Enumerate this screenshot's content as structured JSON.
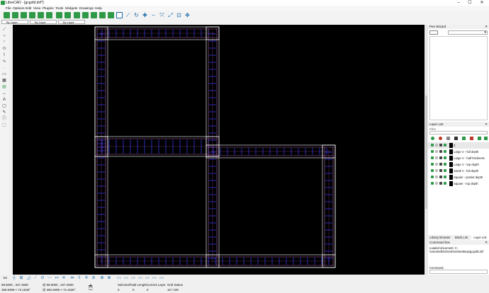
{
  "window": {
    "title": "LibreCAD - [gcgsfd.dxf*]",
    "minimize": "–",
    "maximize": "☐",
    "close": "✕"
  },
  "menu": [
    "File",
    "Options",
    "Edit",
    "View",
    "Plugins",
    "Tools",
    "Widgets",
    "Drawings",
    "Help"
  ],
  "attributes": {
    "color": "By Layer",
    "linetype": "By Layer",
    "width": "By Layer"
  },
  "pen_wizard": {
    "title": "Pen Wizard"
  },
  "layer_list": {
    "title": "Layer List",
    "filter_label": "Filter",
    "layers": [
      {
        "name": "0"
      },
      {
        "name": "Large V - full depth"
      },
      {
        "name": "Large V - half thickness"
      },
      {
        "name": "Large V - top depth"
      },
      {
        "name": "Small V - full depth"
      },
      {
        "name": "Square - pocket depth"
      },
      {
        "name": "Square - top depth"
      }
    ],
    "tabs": [
      "Library Browser",
      "Block List",
      "Layer List"
    ]
  },
  "command_line": {
    "title": "Command line",
    "output_line1": "Loaded document: C:",
    "output_line2": "\\Users\\ellis\\OneDrive\\Desktop\\gcgsfd.dxf",
    "input_label": "Command:"
  },
  "status": {
    "snap_prefix": "Ex",
    "abs_coord": "98.5000 , 347.2500",
    "abs_polar": "360.9499 < 74.1636°",
    "rel_coord": "@  98.5000 , 347.2500",
    "rel_polar": "@  360.9499 < 74.1636°",
    "selected_label": "Selected",
    "selected_value": "0",
    "total_length_label": "Total Length",
    "total_length_value": "0",
    "current_layer_label": "Current Layer",
    "current_layer_value": "0",
    "grid_status_label": "Grid Status",
    "grid_status_value": "10 / 100"
  },
  "colors": {
    "canvas": "#000000",
    "wall_lines": "#b06ab0",
    "grid_ticks": "#3d3dff",
    "outline": "#ffffff",
    "toolbar_green": "#2e9a48",
    "accent_blue": "#1a6aa8"
  }
}
